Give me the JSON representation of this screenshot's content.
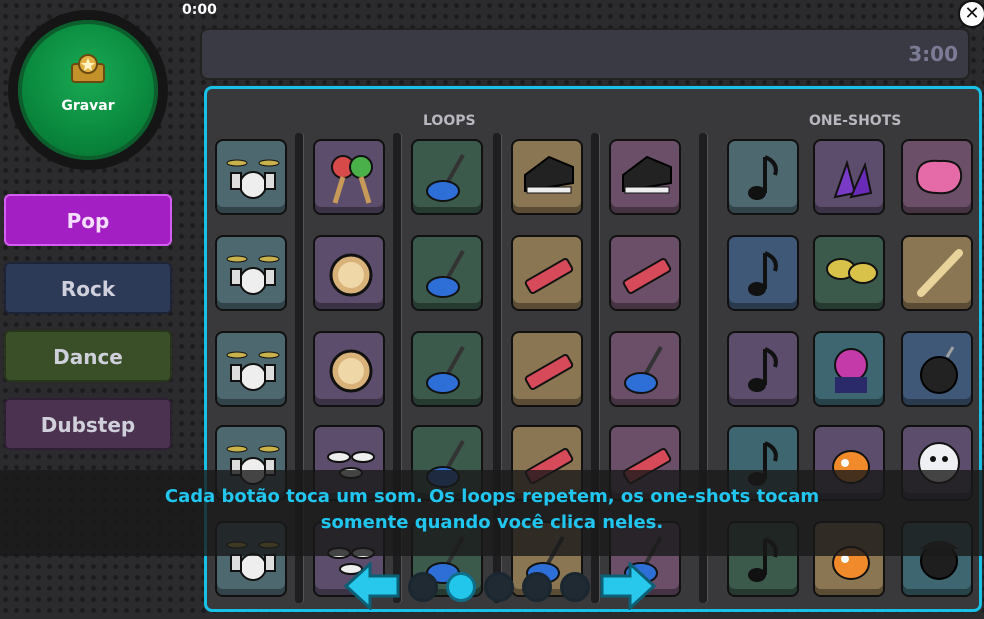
{
  "timer": {
    "start": "0:00",
    "end": "3:00"
  },
  "record_button": {
    "label": "Gravar"
  },
  "genres": [
    {
      "label": "Pop",
      "active": true
    },
    {
      "label": "Rock",
      "active": false
    },
    {
      "label": "Dance",
      "active": false
    },
    {
      "label": "Dubstep",
      "active": false
    }
  ],
  "sections": {
    "loops": "LOOPS",
    "oneshots": "ONE-SHOTS"
  },
  "caption": {
    "line1": "Cada botão toca um som. Os loops repetem, os one-shots tocam",
    "line2": "somente quando você clica neles."
  },
  "pagination": {
    "pages": 5,
    "current": 2
  },
  "colors": {
    "accent": "#19c1e6",
    "record": "#0a8a3e",
    "pop": "#a31fc4"
  },
  "loop_columns": [
    {
      "color": "slate",
      "pads": [
        "drum-kit-icon",
        "drum-kit-icon",
        "drum-kit-icon",
        "drum-kit-icon",
        "drum-kit-icon"
      ]
    },
    {
      "color": "purple",
      "pads": [
        "maracas-icon",
        "tambourine-icon",
        "tambourine-icon",
        "drum-pads-icon",
        "drum-pads-icon"
      ]
    },
    {
      "color": "green",
      "pads": [
        "electric-guitar-icon",
        "electric-guitar-icon",
        "electric-guitar-icon",
        "electric-guitar-icon",
        "electric-guitar-icon"
      ]
    },
    {
      "color": "tan",
      "pads": [
        "grand-piano-icon",
        "keytar-icon",
        "keytar-icon",
        "keytar-icon",
        "electric-guitar-icon"
      ]
    },
    {
      "color": "mauve",
      "pads": [
        "grand-piano-icon",
        "keytar-icon",
        "electric-guitar-icon",
        "keytar-icon",
        "electric-guitar-icon"
      ]
    }
  ],
  "oneshot_columns": [
    {
      "pads": [
        "music-note-icon",
        "music-note-icon",
        "music-note-icon",
        "music-note-icon",
        "music-note-icon"
      ]
    },
    {
      "pads": [
        "hands-icon",
        "cymbals-icon",
        "penguin-dj-icon",
        "puffle-icon",
        "puffle-icon"
      ]
    },
    {
      "pads": [
        "cushion-icon",
        "bat-icon",
        "bomb-icon",
        "polar-bear-icon",
        "pirate-penguin-icon"
      ]
    }
  ]
}
